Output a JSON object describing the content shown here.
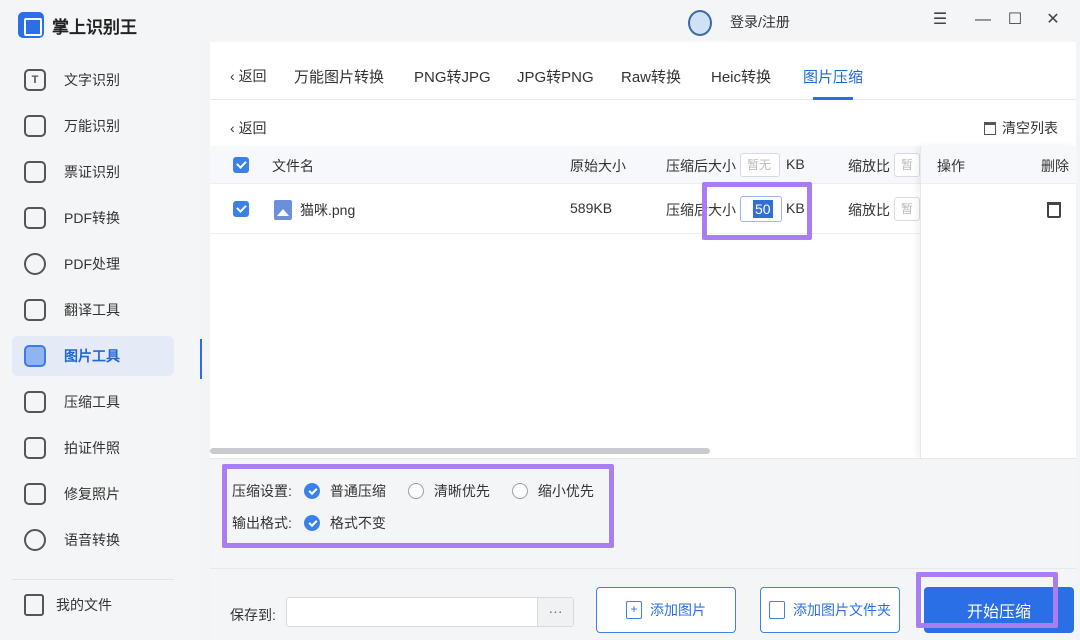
{
  "app": {
    "title": "掌上识别王"
  },
  "sidebar": {
    "items": [
      {
        "label": "文字识别",
        "icon": "text-recognition-icon",
        "glyph": "T"
      },
      {
        "label": "万能识别",
        "icon": "universal-recognition-icon",
        "glyph": ""
      },
      {
        "label": "票证识别",
        "icon": "ticket-recognition-icon",
        "glyph": ""
      },
      {
        "label": "PDF转换",
        "icon": "pdf-convert-icon",
        "glyph": ""
      },
      {
        "label": "PDF处理",
        "icon": "pdf-process-icon",
        "glyph": ""
      },
      {
        "label": "翻译工具",
        "icon": "translate-icon",
        "glyph": ""
      },
      {
        "label": "图片工具",
        "icon": "image-tools-icon",
        "glyph": ""
      },
      {
        "label": "压缩工具",
        "icon": "compress-icon",
        "glyph": ""
      },
      {
        "label": "拍证件照",
        "icon": "id-photo-icon",
        "glyph": ""
      },
      {
        "label": "修复照片",
        "icon": "repair-photo-icon",
        "glyph": ""
      },
      {
        "label": "语音转换",
        "icon": "voice-convert-icon",
        "glyph": ""
      }
    ],
    "my_files": "我的文件"
  },
  "titlebar": {
    "login": "登录/注册",
    "menu_glyph": "☰",
    "minimize_glyph": "—",
    "maximize_glyph": "☐",
    "close_glyph": "✕"
  },
  "tabs": {
    "back": "返回",
    "items": [
      "万能图片转换",
      "PNG转JPG",
      "JPG转PNG",
      "Raw转换",
      "Heic转换",
      "图片压缩"
    ],
    "active": "图片压缩"
  },
  "subheader": {
    "back": "返回",
    "clear_list": "清空列表"
  },
  "table": {
    "headers": {
      "filename": "文件名",
      "original_size": "原始大小",
      "compressed_size": "压缩后大小",
      "compressed_placeholder": "暂无",
      "unit": "KB",
      "scale": "缩放比",
      "scale_placeholder": "暂无",
      "ops": "操作",
      "delete": "删除"
    },
    "rows": [
      {
        "filename": "猫咪.png",
        "original_size": "589KB",
        "compressed_label": "压缩后大小",
        "target_size": "50",
        "unit": "KB",
        "scale_label": "缩放比",
        "scale_placeholder": "暂无"
      }
    ]
  },
  "settings": {
    "compress_label": "压缩设置:",
    "compress_options": [
      "普通压缩",
      "清晰优先",
      "缩小优先"
    ],
    "compress_selected": "普通压缩",
    "format_label": "输出格式:",
    "format_option": "格式不变"
  },
  "bottom": {
    "save_to": "保存到:",
    "save_path": "",
    "browse": "···",
    "add_image": "添加图片",
    "add_folder": "添加图片文件夹",
    "start": "开始压缩"
  },
  "colors": {
    "accent": "#2b6fe6",
    "highlight": "#a97ef0"
  }
}
